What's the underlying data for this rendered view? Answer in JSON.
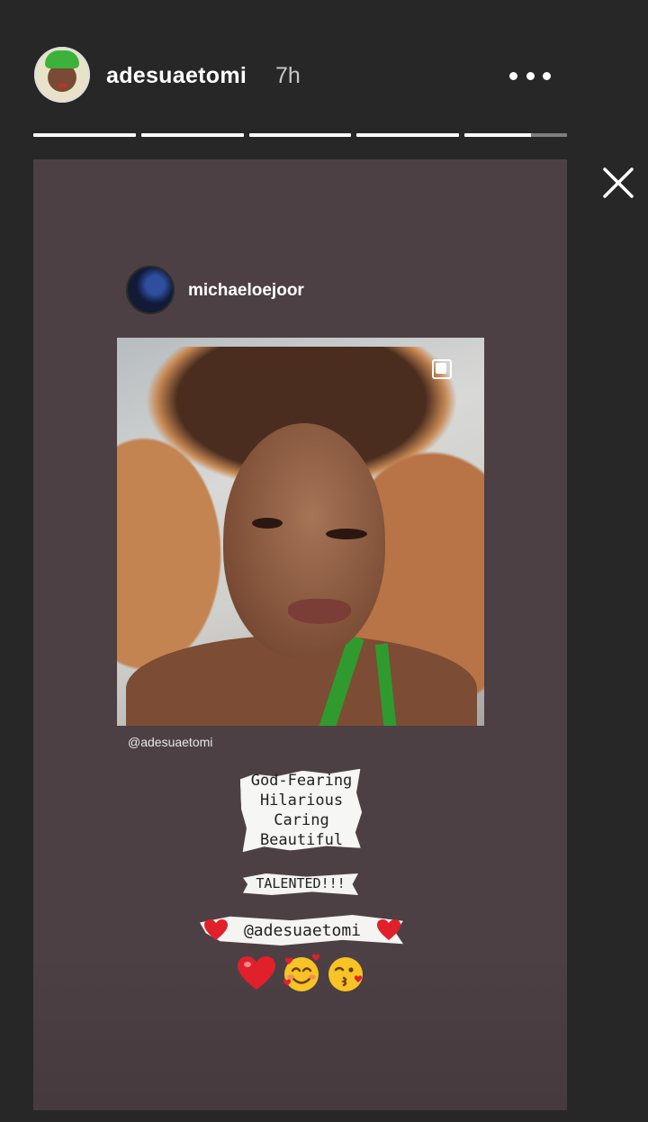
{
  "header": {
    "username": "adesuaetomi",
    "time": "7h",
    "more_icon": "more-dots-icon",
    "close_icon": "close-icon"
  },
  "story": {
    "progress_segments": 5,
    "active_segment_fill": 0.65,
    "shared_post": {
      "username": "michaeloejoor",
      "media_type_icon": "carousel-icon",
      "mention": "@adesuaetomi"
    },
    "stickers": {
      "traits": [
        "God-Fearing",
        "Hilarious",
        "Caring",
        "Beautiful"
      ],
      "talented": "TALENTED!!!",
      "tag": "@adesuaetomi",
      "emojis": [
        "red-heart",
        "smiling-face-with-hearts",
        "face-blowing-kiss"
      ]
    }
  },
  "colors": {
    "background": "#272727",
    "story_background": "#4d4045",
    "sticker_paper": "#f4f4f2",
    "heart_red": "#e0202a"
  }
}
